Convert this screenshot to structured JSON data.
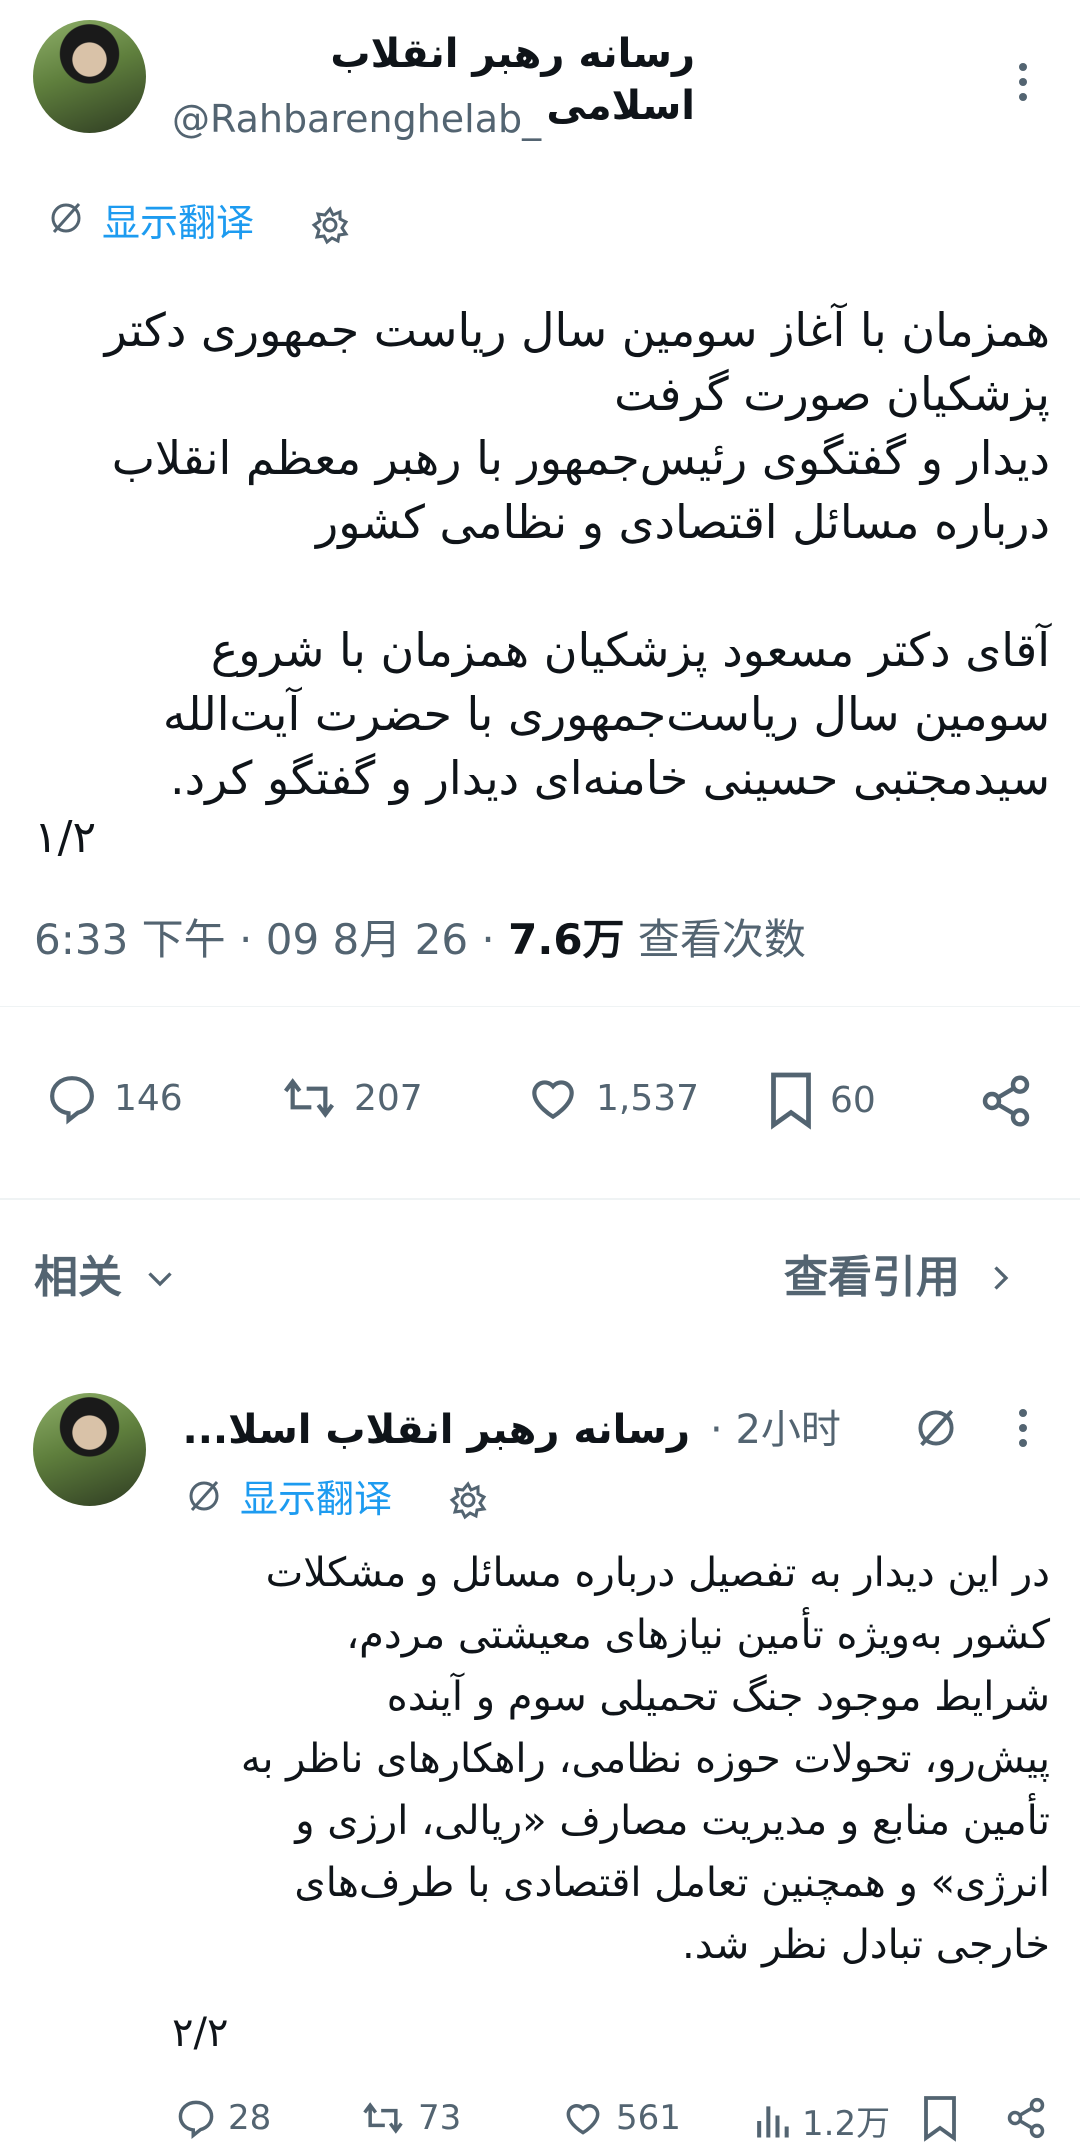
{
  "main_post": {
    "display_name": "رسانه رهبر انقلاب اسلامی",
    "handle": "@Rahbarenghelab_",
    "translate_label": "显示翻译",
    "body_lines": [
      "همزمان با آغاز سومین سال ریاست جمهوری دکتر",
      "پزشکیان صورت گرفت",
      "دیدار و گفتگوی رئیس‌جمهور با رهبر معظم انقلاب",
      "درباره مسائل اقتصادی و نظامی کشور",
      "آقای دکتر مسعود پزشکیان همزمان با شروع",
      "سومین سال ریاست‌جمهوری با حضرت آیت‌الله",
      "سیدمجتبی حسینی خامنه‌ای دیدار و گفتگو کرد."
    ],
    "thread_index": "۱/۲",
    "meta": {
      "time": "6:33 下午",
      "date": "09 8月 26",
      "views": "7.6万",
      "views_label": "查看次数",
      "sep": "·"
    },
    "stats": {
      "replies": "146",
      "reposts": "207",
      "likes": "1,537",
      "bookmarks": "60"
    }
  },
  "related_bar": {
    "related_label": "相关",
    "quotes_label": "查看引用"
  },
  "reply_post": {
    "display_name": "رسانه رهبر انقلاب اسلا...",
    "time_ago": "2小时",
    "sep": "·",
    "translate_label": "显示翻译",
    "body_lines": [
      "در این دیدار به تفصیل درباره مسائل و مشکلات",
      "کشور به‌ویژه تأمین نیازهای معیشتی مردم،",
      "شرایط موجود جنگ تحمیلی سوم و آینده",
      "پیش‌رو، تحولات حوزه نظامی، راهکارهای ناظر به",
      "تأمین منابع و مدیریت مصارف «ریالی، ارزی و",
      "انرژی» و همچنین تعامل اقتصادی با طرف‌های",
      "خارجی تبادل نظر شد."
    ],
    "thread_index": "۲/۲",
    "stats": {
      "replies": "28",
      "reposts": "73",
      "likes": "561",
      "views": "1.2万"
    }
  },
  "colors": {
    "accent": "#1d9bf0",
    "muted": "#536471",
    "text": "#0f1419",
    "divider": "#eff3f4"
  }
}
